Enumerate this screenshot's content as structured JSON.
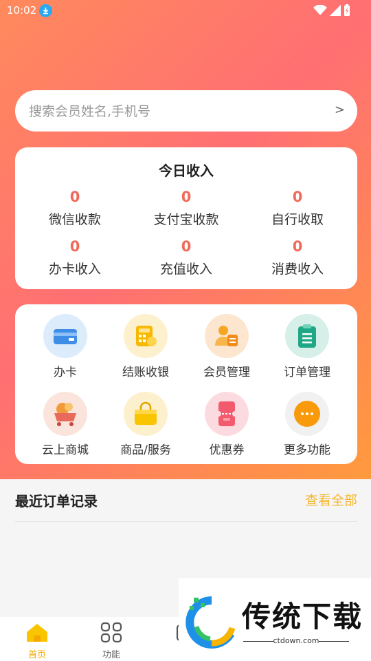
{
  "status_bar": {
    "time": "10:02"
  },
  "search": {
    "placeholder": "搜索会员姓名,手机号",
    "arrow": ">"
  },
  "income": {
    "title": "今日收入",
    "items": [
      {
        "value": "0",
        "label": "微信收款"
      },
      {
        "value": "0",
        "label": "支付宝收款"
      },
      {
        "value": "0",
        "label": "自行收取"
      },
      {
        "value": "0",
        "label": "办卡收入"
      },
      {
        "value": "0",
        "label": "充值收入"
      },
      {
        "value": "0",
        "label": "消费收入"
      }
    ]
  },
  "functions": [
    {
      "label": "办卡",
      "icon": "card-icon"
    },
    {
      "label": "结账收银",
      "icon": "calculator-icon"
    },
    {
      "label": "会员管理",
      "icon": "member-icon"
    },
    {
      "label": "订单管理",
      "icon": "clipboard-icon"
    },
    {
      "label": "云上商城",
      "icon": "shopping-cart-icon"
    },
    {
      "label": "商品/服务",
      "icon": "shopping-bag-icon"
    },
    {
      "label": "优惠券",
      "icon": "coupon-icon"
    },
    {
      "label": "更多功能",
      "icon": "more-icon"
    }
  ],
  "orders": {
    "title": "最近订单记录",
    "view_all": "查看全部"
  },
  "tabbar": {
    "tabs": [
      {
        "label": "首页",
        "icon": "home-icon",
        "active": true
      },
      {
        "label": "功能",
        "icon": "grid-icon",
        "active": false
      },
      {
        "label": "",
        "icon": "partial-icon",
        "active": false
      }
    ]
  },
  "watermark": {
    "brand": "传统下载",
    "site": "ctdown.com"
  },
  "colors": {
    "accent_number": "#f06a5b",
    "link": "#f5b62e",
    "tab_active": "#f5a800"
  }
}
